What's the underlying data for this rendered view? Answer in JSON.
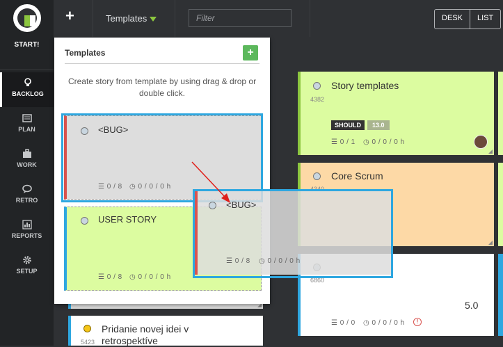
{
  "sidebar": {
    "start_label": "START!",
    "items": [
      {
        "label": "BACKLOG",
        "icon": "lightbulb-icon",
        "active": true
      },
      {
        "label": "PLAN",
        "icon": "list-icon"
      },
      {
        "label": "WORK",
        "icon": "briefcase-icon"
      },
      {
        "label": "RETRO",
        "icon": "chat-icon"
      },
      {
        "label": "REPORTS",
        "icon": "bar-chart-icon"
      },
      {
        "label": "SETUP",
        "icon": "gear-icon"
      }
    ]
  },
  "topbar": {
    "add_label": "+",
    "templates_label": "Templates",
    "filter_placeholder": "Filter",
    "view_desk": "DESK",
    "view_list": "LIST"
  },
  "templates_panel": {
    "title": "Templates",
    "add_label": "+",
    "description": "Create story from template by using drag & drop or double click.",
    "items": [
      {
        "title": "<BUG>",
        "stats_tasks": "0 / 8",
        "stats_time": "0 / 0 / 0 h"
      },
      {
        "title": "USER STORY",
        "stats_tasks": "0 / 8",
        "stats_time": "0 / 0 / 0 h"
      }
    ]
  },
  "dragging": {
    "title": "<BUG>",
    "stats_tasks": "0 / 8",
    "stats_time": "0 / 0 / 0 h"
  },
  "board": {
    "left_card": {
      "id": "5423",
      "title": "Pridanie novej idei v retrospektíve"
    },
    "cards": [
      {
        "id": "4382",
        "title": "Story templates",
        "badge": "SHOULD",
        "points": "13.0",
        "stats_tasks": "0 / 1",
        "stats_time": "0 / 0 / 0 h"
      },
      {
        "id": "4340",
        "title": "Core Scrum"
      },
      {
        "id": "6860",
        "title": "",
        "points": "5.0",
        "stats_tasks": "0 / 0",
        "stats_time": "0 / 0 / 0 h"
      }
    ]
  },
  "colors": {
    "green": "#dcfca0",
    "orange": "#fdd9a6",
    "accent": "#2ea7e0",
    "red": "#d9534f"
  }
}
